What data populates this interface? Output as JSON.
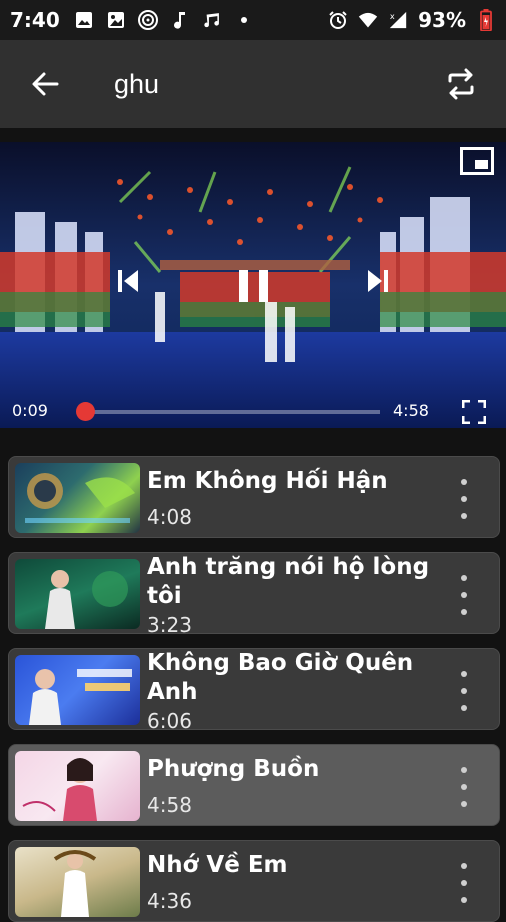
{
  "status_bar": {
    "time": "7:40",
    "battery": "93%",
    "icons_left": [
      "image-icon",
      "photo-icon",
      "disc-icon",
      "music-note-icon",
      "music-notes-icon",
      "dot-icon"
    ],
    "icons_right": [
      "alarm-icon",
      "wifi-icon",
      "signal-icon",
      "battery-icon"
    ]
  },
  "app_bar": {
    "back_icon": "arrow-left-icon",
    "title": "ghu",
    "repeat_icon": "repeat-icon"
  },
  "player": {
    "current_time": "0:09",
    "total_time": "4:58",
    "progress": 0.03,
    "controls": [
      "pip-icon",
      "previous-icon",
      "pause-icon",
      "next-icon",
      "fullscreen-icon"
    ]
  },
  "playlist": [
    {
      "title": "Em Không Hối Hận",
      "duration": "4:08",
      "active": false
    },
    {
      "title": "Anh trăng nói hộ lòng tôi",
      "duration": "3:23",
      "active": false
    },
    {
      "title": "Không Bao Giờ Quên Anh",
      "duration": "6:06",
      "active": false
    },
    {
      "title": "Phượng Buồn",
      "duration": "4:58",
      "active": true
    },
    {
      "title": "Nhớ Về Em",
      "duration": "4:36",
      "active": false
    }
  ],
  "colors": {
    "accent": "#e53935",
    "app_bar": "#303030",
    "card": "#3a3a3a",
    "card_active": "#5c5c5c",
    "background": "#121212"
  }
}
